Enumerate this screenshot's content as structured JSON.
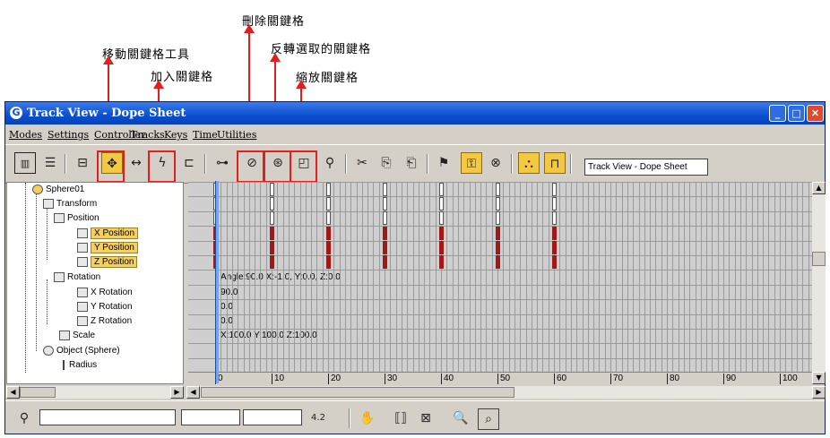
{
  "annotations": {
    "move_keys_tool": "移動關鍵格工具",
    "add_keys": "加入關鍵格",
    "delete_keys": "刪除關鍵格",
    "invert_selection": "反轉選取的關鍵格",
    "scale_keys": "縮放關鍵格"
  },
  "window": {
    "title": "Track View - Dope Sheet",
    "minimize": "_",
    "maximize": "□",
    "close": "✕"
  },
  "menu": [
    "Modes",
    "Settings",
    "Controller",
    "Tracks",
    "Keys",
    "Time",
    "Utilities"
  ],
  "toolbar": {
    "track_view_name": "Track View - Dope Sheet",
    "icons": [
      "edit-keys-icon",
      "edit-ranges-icon",
      "filters-icon",
      "move-keys-icon",
      "slide-keys-icon",
      "add-keys-icon",
      "scale-keys-icon",
      "select-time-icon",
      "delete-keys-icon",
      "scale-keys-time-icon",
      "insert-time-icon",
      "reduce-keys-icon",
      "copy-icon",
      "paste-icon",
      "show-keyable-icon",
      "lock-selection-icon",
      "snap-frames-icon",
      "modify-subtree-icon",
      "modify-child-keys-icon"
    ]
  },
  "tree": [
    {
      "label": "Sphere01",
      "highlight": false
    },
    {
      "label": "Transform",
      "highlight": false
    },
    {
      "label": "Position",
      "highlight": false
    },
    {
      "label": "X Position",
      "highlight": true
    },
    {
      "label": "Y Position",
      "highlight": true
    },
    {
      "label": "Z Position",
      "highlight": true
    },
    {
      "label": "Rotation",
      "highlight": false
    },
    {
      "label": "X Rotation",
      "highlight": false
    },
    {
      "label": "Y Rotation",
      "highlight": false
    },
    {
      "label": "Z Rotation",
      "highlight": false
    },
    {
      "label": "Scale",
      "highlight": false
    },
    {
      "label": "Object (Sphere)",
      "highlight": false
    },
    {
      "label": "Radius",
      "highlight": false
    }
  ],
  "sheet_values": {
    "rotation": "Angle:90.0 X:-1.0, Y:0.0, Z:0.0",
    "x_rotation": "90.0",
    "y_rotation": "0.0",
    "z_rotation": "0.0",
    "scale": "X:100.0 Y:100.0 Z:100.0"
  },
  "key_frames": [
    0,
    10,
    20,
    30,
    40,
    50,
    60
  ],
  "ruler": [
    "0",
    "10",
    "20",
    "30",
    "40",
    "50",
    "60",
    "70",
    "80",
    "90",
    "100"
  ],
  "status": {
    "zoom_value": "4.2"
  },
  "colors": {
    "selected_key": "#a01818",
    "highlight": "#f5d060",
    "annotation_box": "#e02020"
  }
}
